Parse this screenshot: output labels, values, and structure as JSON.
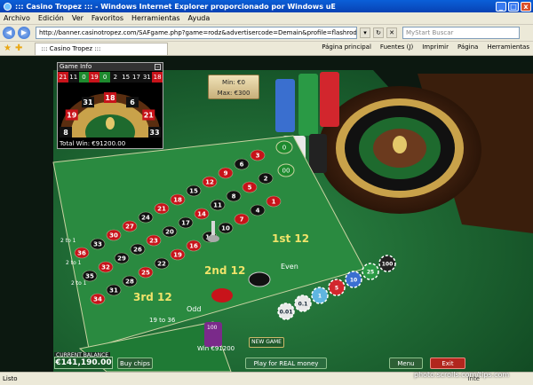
{
  "window": {
    "title": "::: Casino Tropez ::: - Windows Internet Explorer proporcionado por Windows uE",
    "min": "_",
    "max": "□",
    "close": "x"
  },
  "menu": [
    "Archivo",
    "Edición",
    "Ver",
    "Favoritos",
    "Herramientas",
    "Ayuda"
  ],
  "address": {
    "url": "http://banner.casinotropez.com/SAFgame.php?game=rodz&advertisercode=Demain&profile=flashrodz&affiliateRedirectMode",
    "search_placeholder": "MyStart Buscar"
  },
  "tab": {
    "label": "::: Casino Tropez :::"
  },
  "toolbar": {
    "home": "Página principal",
    "feeds": "Fuentes (J)",
    "print": "Imprimir",
    "page": "Página",
    "tools": "Herramientas"
  },
  "game_info": {
    "title": "Game Info",
    "recent": [
      {
        "n": "21",
        "c": "#c8131a"
      },
      {
        "n": "11",
        "c": "#111"
      },
      {
        "n": "0",
        "c": "#1e8a2e"
      },
      {
        "n": "19",
        "c": "#c8131a"
      },
      {
        "n": "0",
        "c": "#1e8a2e"
      },
      {
        "n": "2",
        "c": "#111"
      },
      {
        "n": "15",
        "c": "#111"
      },
      {
        "n": "17",
        "c": "#111"
      },
      {
        "n": "31",
        "c": "#111"
      },
      {
        "n": "18",
        "c": "#c8131a"
      }
    ],
    "wheel_numbers": [
      "8",
      "19",
      "31",
      "18",
      "6",
      "21",
      "33"
    ],
    "total_win": "Total Win: €91200.00"
  },
  "limits": {
    "min": "Min: €0",
    "max": "Max: €300"
  },
  "board": {
    "dozens": [
      "1st 12",
      "2nd 12",
      "3rd 12"
    ],
    "outside": [
      "Even",
      "Odd",
      "19 to 36"
    ],
    "columns": [
      "2 to 1",
      "2 to 1",
      "2 to 1"
    ],
    "numbers": [
      {
        "n": "3",
        "c": "r"
      },
      {
        "n": "6",
        "c": "b"
      },
      {
        "n": "9",
        "c": "r"
      },
      {
        "n": "12",
        "c": "r"
      },
      {
        "n": "15",
        "c": "b"
      },
      {
        "n": "18",
        "c": "r"
      },
      {
        "n": "21",
        "c": "r"
      },
      {
        "n": "24",
        "c": "b"
      },
      {
        "n": "27",
        "c": "r"
      },
      {
        "n": "30",
        "c": "r"
      },
      {
        "n": "33",
        "c": "b"
      },
      {
        "n": "36",
        "c": "r"
      },
      {
        "n": "2",
        "c": "b"
      },
      {
        "n": "5",
        "c": "r"
      },
      {
        "n": "8",
        "c": "b"
      },
      {
        "n": "11",
        "c": "b"
      },
      {
        "n": "14",
        "c": "r"
      },
      {
        "n": "17",
        "c": "b"
      },
      {
        "n": "20",
        "c": "b"
      },
      {
        "n": "23",
        "c": "r"
      },
      {
        "n": "26",
        "c": "b"
      },
      {
        "n": "29",
        "c": "b"
      },
      {
        "n": "32",
        "c": "r"
      },
      {
        "n": "35",
        "c": "b"
      },
      {
        "n": "1",
        "c": "r"
      },
      {
        "n": "4",
        "c": "b"
      },
      {
        "n": "7",
        "c": "r"
      },
      {
        "n": "10",
        "c": "b"
      },
      {
        "n": "13",
        "c": "b"
      },
      {
        "n": "16",
        "c": "r"
      },
      {
        "n": "19",
        "c": "r"
      },
      {
        "n": "22",
        "c": "b"
      },
      {
        "n": "25",
        "c": "r"
      },
      {
        "n": "28",
        "c": "b"
      },
      {
        "n": "31",
        "c": "b"
      },
      {
        "n": "34",
        "c": "r"
      }
    ],
    "zero": "0",
    "double_zero": "00"
  },
  "chips": [
    {
      "v": "0.01",
      "c": "#e9e9e9"
    },
    {
      "v": "0.1",
      "c": "#e9e9e9"
    },
    {
      "v": "1",
      "c": "#5fb5e0"
    },
    {
      "v": "5",
      "c": "#d2262d"
    },
    {
      "v": "10",
      "c": "#3b6fd0"
    },
    {
      "v": "25",
      "c": "#2a9a45"
    },
    {
      "v": "100",
      "c": "#222"
    }
  ],
  "bet_stack": {
    "value": "100"
  },
  "win": "Win €91200",
  "balance": {
    "label": "CURRENT BALANCE",
    "value": "€141,190.00"
  },
  "buttons": {
    "buy_chips": "Buy chips",
    "play_real": "Play for REAL money",
    "menu": "Menu",
    "exit": "Exit",
    "new_game": "NEW GAME"
  },
  "status": {
    "left": "Listo",
    "right": "Inte"
  },
  "watermark": "photo.scrolls.com/tips.com"
}
